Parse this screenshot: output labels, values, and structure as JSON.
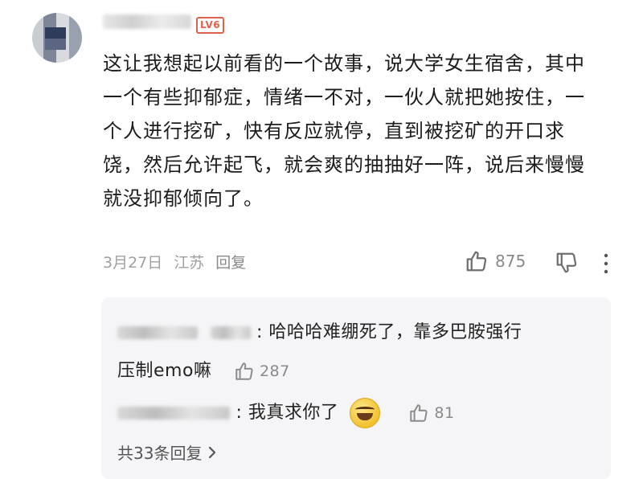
{
  "comment": {
    "level_badge": "LV6",
    "text": "这让我想起以前看的一个故事，说大学女生宿舍，其中一个有些抑郁症，情绪一不对，一伙人就把她按住，一个人进行挖矿，快有反应就停，直到被挖矿的开口求饶，然后允许起飞，就会爽的抽抽好一阵，说后来慢慢就没抑郁倾向了。",
    "date": "3月27日",
    "location": "江苏",
    "reply_label": "回复",
    "like_count": "875"
  },
  "replies": [
    {
      "text": ": 哈哈哈难绷死了，靠多巴胺强行",
      "text_cont": "压制emo嘛",
      "like_count": "287"
    },
    {
      "text": ": 我真求你了",
      "like_count": "81"
    }
  ],
  "total_replies_label": "共33条回复"
}
